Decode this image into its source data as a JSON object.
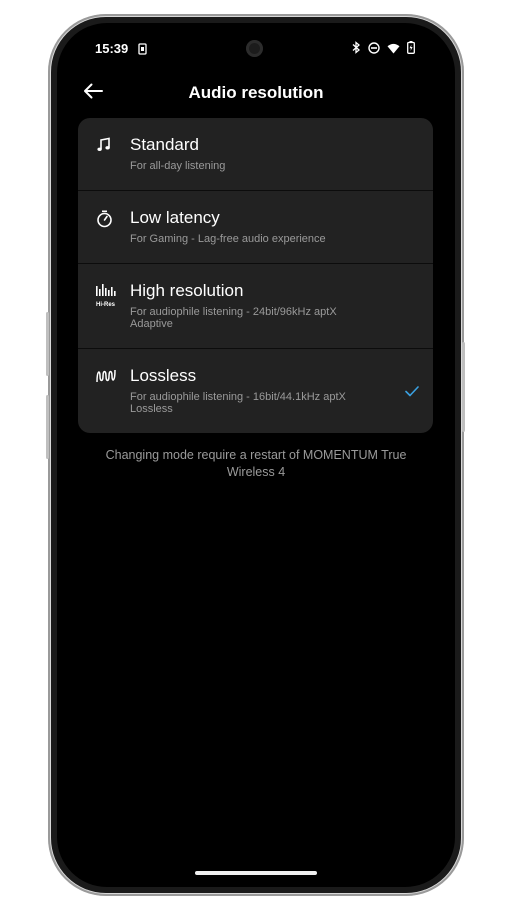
{
  "status_bar": {
    "time": "15:39",
    "icons": [
      "battery-saver-icon",
      "bluetooth-icon",
      "do-not-disturb-icon",
      "wifi-icon",
      "battery-icon"
    ]
  },
  "app_bar": {
    "title": "Audio resolution",
    "back_icon": "arrow-left-icon"
  },
  "options": [
    {
      "id": "standard",
      "title": "Standard",
      "description": "For all-day listening",
      "icon": "music-note-icon",
      "selected": false
    },
    {
      "id": "low-latency",
      "title": "Low latency",
      "description": "For Gaming - Lag-free audio experience",
      "icon": "stopwatch-icon",
      "selected": false
    },
    {
      "id": "high-resolution",
      "title": "High resolution",
      "description": "For audiophile listening - 24bit/96kHz aptX Adaptive",
      "icon": "hi-res-icon",
      "icon_label": "Hi-Res",
      "selected": false
    },
    {
      "id": "lossless",
      "title": "Lossless",
      "description": "For audiophile listening - 16bit/44.1kHz aptX Lossless",
      "icon": "waveform-icon",
      "selected": true
    }
  ],
  "footer_note": "Changing mode require a restart of MOMENTUM True Wireless 4",
  "colors": {
    "background": "#000000",
    "card": "#222222",
    "accent_check": "#3aa0e0",
    "secondary_text": "#9a9a9a"
  }
}
